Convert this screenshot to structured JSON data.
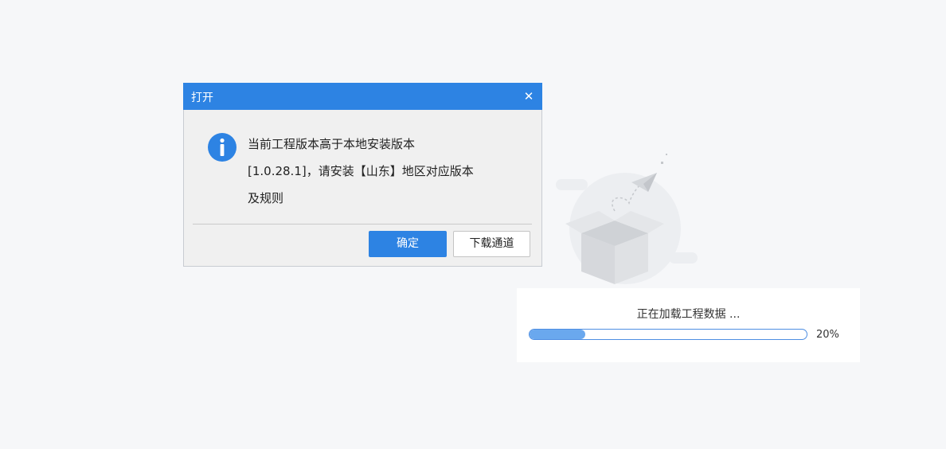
{
  "dialog": {
    "title": "打开",
    "close_symbol": "✕",
    "message_lines": [
      "当前工程版本高于本地安装版本",
      "[1.0.28.1]，请安装【山东】地区对应版本",
      "及规则"
    ],
    "icon": "info-icon",
    "confirm_label": "确定",
    "download_label": "下载通道"
  },
  "loading": {
    "text": "正在加载工程数据 ...",
    "progress_percent": 20,
    "progress_label": "20%"
  },
  "colors": {
    "accent": "#2d83e3",
    "progress_fill": "#6aa8ee",
    "background": "#f6f7f9"
  }
}
